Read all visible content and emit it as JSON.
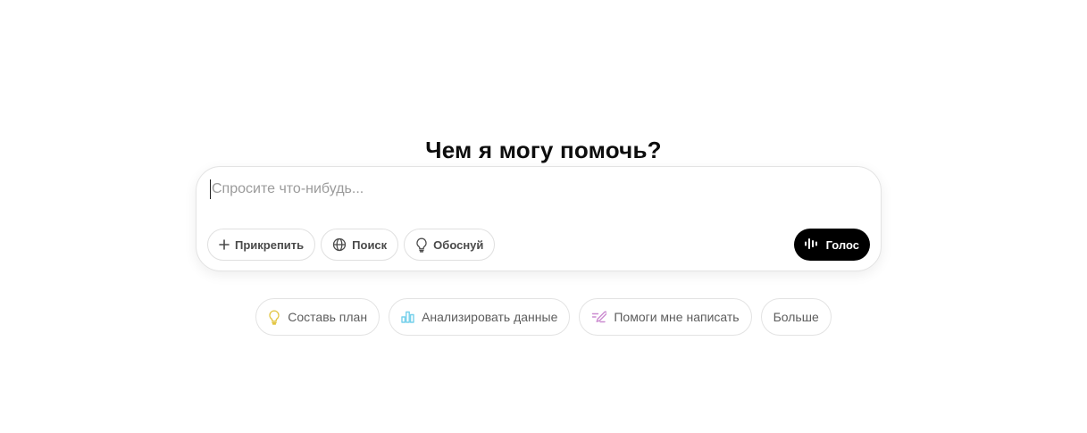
{
  "heading": "Чем я могу помочь?",
  "composer": {
    "placeholder": "Спросите что-нибудь...",
    "value": "",
    "tools": [
      {
        "label": "Прикрепить",
        "icon": "plus-icon"
      },
      {
        "label": "Поиск",
        "icon": "globe-icon"
      },
      {
        "label": "Обоснуй",
        "icon": "lightbulb-icon"
      }
    ],
    "voice": {
      "label": "Голос",
      "icon": "voice-waveform-icon"
    }
  },
  "suggestions": [
    {
      "label": "Составь план",
      "icon": "lightbulb-icon",
      "icon_color": "#e2c541"
    },
    {
      "label": "Анализировать данные",
      "icon": "bar-chart-icon",
      "icon_color": "#76d0eb"
    },
    {
      "label": "Помоги мне написать",
      "icon": "pen-icon",
      "icon_color": "#cb8bd0"
    },
    {
      "label": "Больше",
      "icon": "",
      "icon_color": ""
    }
  ],
  "colors": {
    "voice_button": "#000000",
    "border": "#e3e3e3",
    "placeholder": "#9b9b9b"
  }
}
